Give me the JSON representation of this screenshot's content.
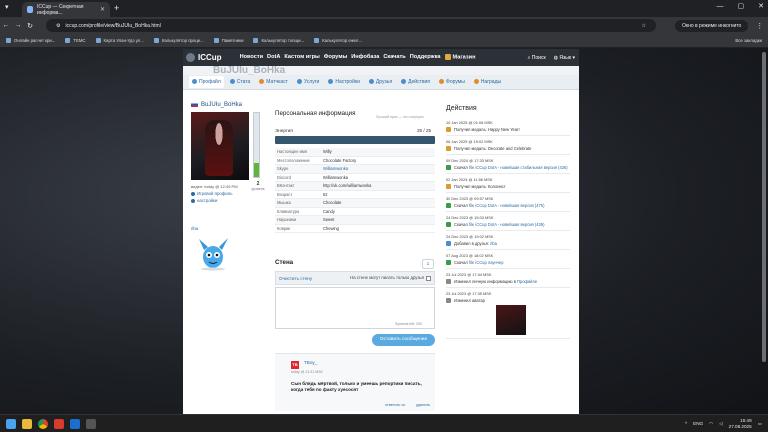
{
  "browser": {
    "tab_title": "ICCup — Секретная информа...",
    "url": "iccup.com/profile/view/BuJUIu_BoHka.html",
    "incognito_label": "Окно в режиме инкогнито",
    "bookmarks": [
      "Онлайн расчет кри...",
      "TEMC",
      "Карта Улан-Удэ ул...",
      "Калькулятор проце...",
      "Памятники",
      "Калькулятор толщи...",
      "Калькулятор ежел..."
    ],
    "all_bookmarks": "Все закладки"
  },
  "site": {
    "logo": "ICCup",
    "nav": [
      "Новости",
      "DotA",
      "Кастом игры",
      "Форумы",
      "Инфобаза",
      "Скачать",
      "Поддержка",
      "Магазин"
    ],
    "search": "Поиск",
    "lang": "Язык",
    "subtitle": "BuJUIu_BoHka",
    "subtabs": [
      {
        "label": "Профайл",
        "color": "#4a8ed0"
      },
      {
        "label": "Стата",
        "color": "#4a8ed0"
      },
      {
        "label": "Матчкаст",
        "color": "#e08c2c"
      },
      {
        "label": "Услуги",
        "color": "#4a8ed0"
      },
      {
        "label": "Настройки",
        "color": "#4a8ed0"
      },
      {
        "label": "Друзья",
        "color": "#4a8ed0"
      },
      {
        "label": "Действия",
        "color": "#4a8ed0"
      },
      {
        "label": "Форумы",
        "color": "#e08c2c"
      },
      {
        "label": "Награды",
        "color": "#e08c2c"
      }
    ]
  },
  "profile": {
    "name": "BuJUIu_BoHka",
    "level": "2",
    "level_label": "уровень",
    "level_fill": 0.22,
    "seen": "виден: today @ 12:49 PM",
    "game_profile": "Игровой профиль",
    "settings": "настройки",
    "friend_label": "riba"
  },
  "info": {
    "title": "Персональная информация",
    "hint": "Лучший приз — это сюрприз",
    "energy_label": "Энергия",
    "energy_value": "25 / 25",
    "energy_fill": 1.0,
    "rows": [
      {
        "k": "Настоящее имя",
        "v": "Willy",
        "link": false
      },
      {
        "k": "Местоположение",
        "v": "Chocolate Factory",
        "link": false
      },
      {
        "k": "Skype",
        "v": "Williamwonka",
        "link": true
      },
      {
        "k": "Discord",
        "v": "Williamwonka",
        "link": false
      },
      {
        "k": "ВКонтакт",
        "v": "http://vk.com/williamwonka",
        "link": false
      },
      {
        "k": "Возраст",
        "v": "52",
        "link": false
      },
      {
        "k": "Мышка",
        "v": "Chocolate",
        "link": false
      },
      {
        "k": "Клавиатура",
        "v": "Candy",
        "link": false
      },
      {
        "k": "Наушники",
        "v": "Sweet",
        "link": false
      },
      {
        "k": "Коврик",
        "v": "Chewing",
        "link": false
      }
    ]
  },
  "wall": {
    "title": "Стена",
    "count": "1",
    "clear": "Очистить стену",
    "only_friends": "На стене могут писать только друзья",
    "symbols_left": "Symbols left: 200",
    "post_button": "Оставить сообщение",
    "post": {
      "avatar": "TB",
      "author": "TBoy_",
      "time": "today @ 11:31 MSK",
      "text": "Сын блядь мёртвой, только и умеешь репортики писать, когда тебя по факту хуесосят",
      "reply": "ответить ос",
      "delete": "удалить"
    }
  },
  "actions": {
    "title": "Действия",
    "items": [
      {
        "date": "10 Jan 2025 @ 01:06 MSK",
        "icon": "#e09a2b",
        "text": "Получил медаль: Happy New Year!",
        "link": ""
      },
      {
        "date": "06 Jan 2025 @ 19:02 MSK",
        "icon": "#e09a2b",
        "text": "Получил медаль: Decorate and Celebrate",
        "link": ""
      },
      {
        "date": "09 Dec 2024 @ 17:33 MSK",
        "icon": "#3c9a4a",
        "text": "Скачал",
        "link": "file iCCup DotA - новейшая стабильная версия (426)"
      },
      {
        "date": "02 Jan 2024 @ 11:56 MSK",
        "icon": "#e09a2b",
        "text": "Получил медаль: Колонист",
        "link": ""
      },
      {
        "date": "30 Dec 2023 @ 09:57 MSK",
        "icon": "#3c9a4a",
        "text": "Скачал",
        "link": "file iCCup DotA - новейшая версия (475)"
      },
      {
        "date": "24 Dec 2023 @ 15:03 MSK",
        "icon": "#3c9a4a",
        "text": "Скачал",
        "link": "file iCCup DotA - новейшая версия (439)"
      },
      {
        "date": "24 Dec 2023 @ 19:02 MSK",
        "icon": "#4a8ed0",
        "text": "Добавил в друзья:",
        "link": "riba"
      },
      {
        "date": "07 Aug 2023 @ 18:02 MSK",
        "icon": "#3c9a4a",
        "text": "Скачал",
        "link": "file iCCup лаунчер"
      },
      {
        "date": "23 Jul 2023 @ 17:44 MSK",
        "icon": "#888888",
        "text": "Изменил личную информацию в",
        "link": "Профайле"
      },
      {
        "date": "23 Jul 2023 @ 17:35 MSK",
        "icon": "#888888",
        "text": "Изменил аватар",
        "link": ""
      }
    ]
  },
  "taskbar": {
    "lang": "ENG",
    "time": "15:49",
    "date": "27.08.2025"
  }
}
